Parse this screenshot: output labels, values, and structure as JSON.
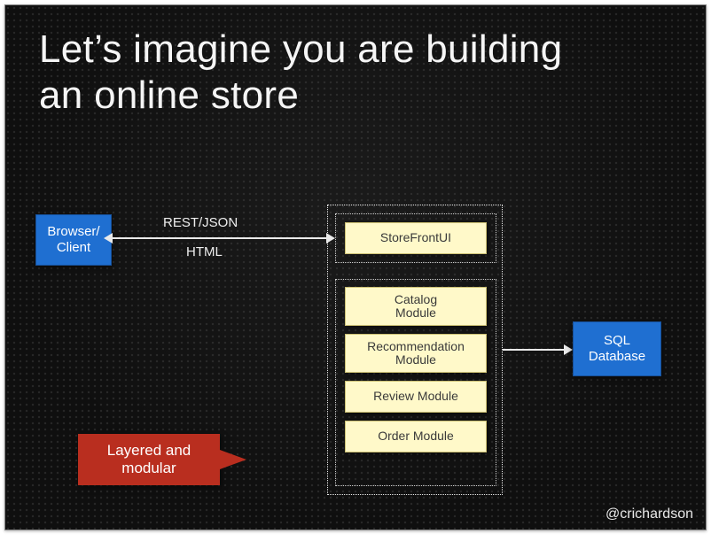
{
  "title": "Let’s imagine you are building an online store",
  "handle": "@crichardson",
  "client_label": "Browser/\nClient",
  "arrow_top": "REST/JSON",
  "arrow_bottom": "HTML",
  "ui_box": "StoreFrontUI",
  "modules": {
    "catalog": "Catalog\nModule",
    "recommendation": "Recommendation\nModule",
    "review": "Review Module",
    "order": "Order Module"
  },
  "db_label": "SQL\nDatabase",
  "callout": "Layered and\nmodular",
  "colors": {
    "blue": "#1f6fd1",
    "yellow": "#fff9c9",
    "red": "#b92e1f",
    "bg": "#0f0f0f"
  }
}
